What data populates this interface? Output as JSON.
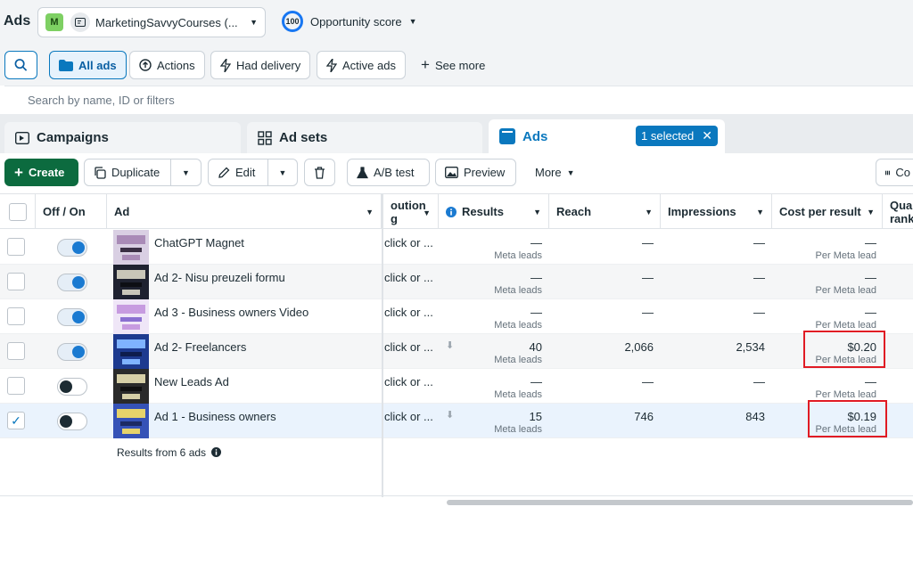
{
  "header": {
    "title": "Ads",
    "account_initial": "M",
    "account_name": "MarketingSavvyCourses (...",
    "opportunity_value": "100",
    "opportunity_label": "Opportunity score"
  },
  "filters": {
    "all_ads": "All ads",
    "actions": "Actions",
    "had_delivery": "Had delivery",
    "active_ads": "Active ads",
    "see_more": "See more"
  },
  "search": {
    "placeholder": "Search by name, ID or filters"
  },
  "tabs": {
    "campaigns": "Campaigns",
    "ad_sets": "Ad sets",
    "ads": "Ads",
    "selected_badge": "1 selected"
  },
  "toolbar": {
    "create": "Create",
    "duplicate": "Duplicate",
    "edit": "Edit",
    "ab_test": "A/B test",
    "preview": "Preview",
    "more": "More",
    "columns": "Co"
  },
  "columns": {
    "off_on": "Off / On",
    "ad": "Ad",
    "attribution_line1": "oution",
    "attribution_line2": "g",
    "results": "Results",
    "reach": "Reach",
    "impressions": "Impressions",
    "cost_per_result": "Cost per result",
    "quality_line1": "Qual",
    "quality_line2": "rank"
  },
  "rows": [
    {
      "name": "ChatGPT Magnet",
      "attribution": "click or ...",
      "results": "—",
      "results_sub": "Meta leads",
      "reach": "—",
      "impressions": "—",
      "cost": "—",
      "cost_sub": "Per Meta lead",
      "toggle": "on",
      "checked": false
    },
    {
      "name": "Ad 2- Nisu preuzeli formu",
      "attribution": "click or ...",
      "results": "—",
      "results_sub": "Meta leads",
      "reach": "—",
      "impressions": "—",
      "cost": "—",
      "cost_sub": "Per Meta lead",
      "toggle": "on",
      "checked": false
    },
    {
      "name": "Ad 3 - Business owners Video",
      "attribution": "click or ...",
      "results": "—",
      "results_sub": "Meta leads",
      "reach": "—",
      "impressions": "—",
      "cost": "—",
      "cost_sub": "Per Meta lead",
      "toggle": "on",
      "checked": false
    },
    {
      "name": "Ad 2- Freelancers",
      "attribution": "click or ...",
      "results": "40",
      "results_sub": "Meta leads",
      "reach": "2,066",
      "impressions": "2,534",
      "cost": "$0.20",
      "cost_sub": "Per Meta lead",
      "toggle": "on",
      "checked": false
    },
    {
      "name": "New Leads Ad",
      "attribution": "click or ...",
      "results": "—",
      "results_sub": "Meta leads",
      "reach": "—",
      "impressions": "—",
      "cost": "—",
      "cost_sub": "Per Meta lead",
      "toggle": "off",
      "checked": false
    },
    {
      "name": "Ad 1 - Business owners",
      "attribution": "click or ...",
      "results": "15",
      "results_sub": "Meta leads",
      "reach": "746",
      "impressions": "843",
      "cost": "$0.19",
      "cost_sub": "Per Meta lead",
      "toggle": "off",
      "checked": true
    }
  ],
  "footer": {
    "results_text": "Results from 6 ads"
  },
  "colors": {
    "accent": "#0a78be",
    "create_green": "#0c6b3f",
    "highlight_red": "#e01b24"
  }
}
